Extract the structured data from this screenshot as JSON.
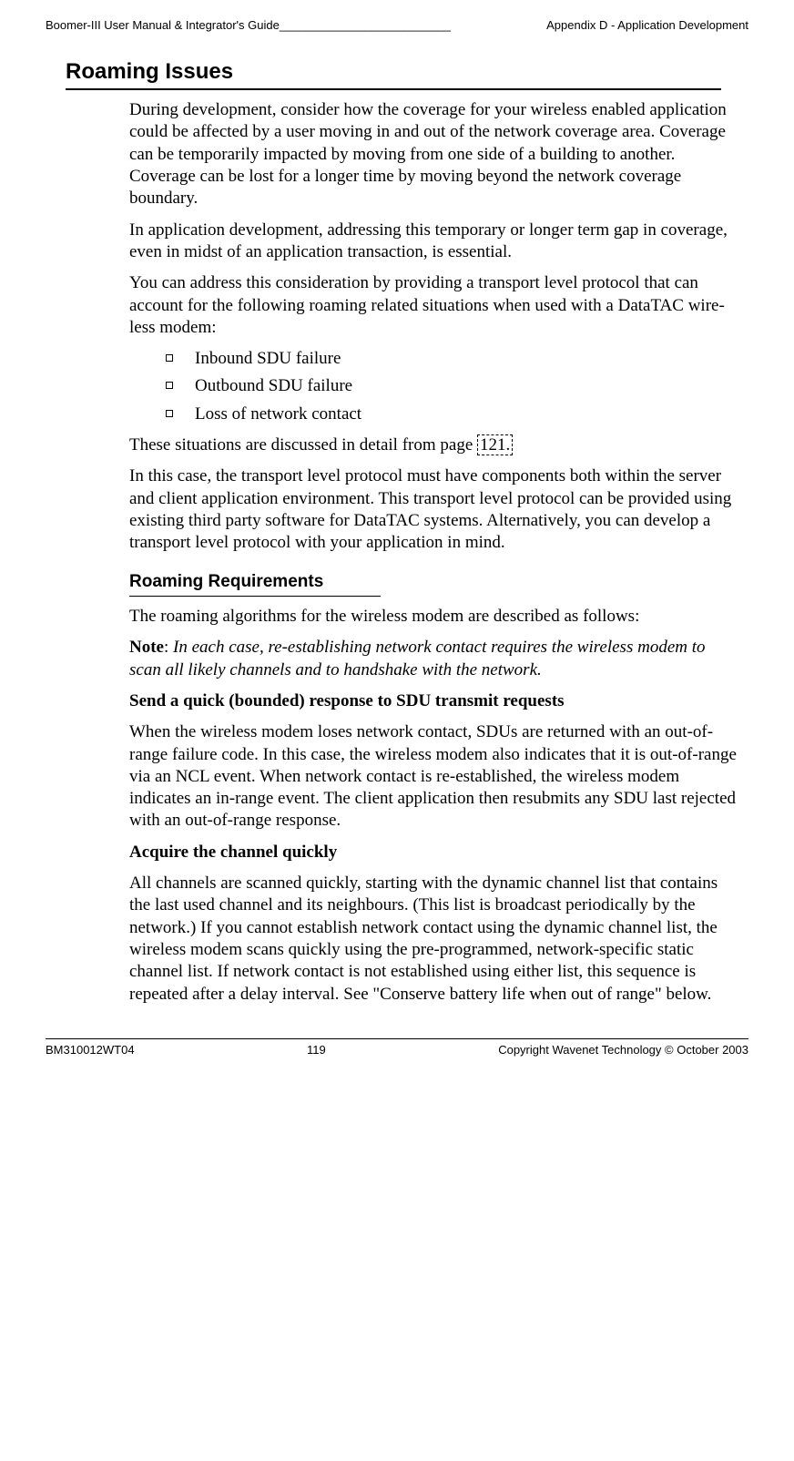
{
  "header": {
    "left": "Boomer-III User Manual & Integrator's Guide__________________________",
    "right": "Appendix D - Application Development"
  },
  "title": "Roaming Issues",
  "p1": "During development, consider how the coverage for your wireless enabled application could be affected by a user moving in and out of the network coverage area. Coverage can be temporarily impacted by moving from one side of a building to another. Coverage can be lost for a longer time by moving beyond the network coverage boundary.",
  "p2": "In application development, addressing this temporary or longer term gap in coverage, even in midst of an application transaction, is essential.",
  "p3": "You can address this consideration by providing a transport level protocol that can account for the following roaming related situations when used with a DataTAC wire-less modem:",
  "bullets": {
    "b1": "Inbound SDU failure",
    "b2": "Outbound SDU failure",
    "b3": "Loss of network contact"
  },
  "p4a": "These situations are discussed in detail from page ",
  "p4b": "121.",
  "p5": "In this case, the transport level protocol must have components both within the server and client application environment. This transport level protocol can be provided using existing third party software for DataTAC systems. Alternatively, you can develop a transport level protocol with your application in mind.",
  "subheading": "Roaming Requirements",
  "p6": "The roaming algorithms for the wireless modem are described as follows:",
  "note_label": "Note",
  "note_sep": ": ",
  "note_body": "In each case, re-establishing network contact requires the wireless modem to scan all likely channels and to handshake with the network.",
  "runin1": "Send a quick (bounded) response to SDU transmit requests",
  "p7": "When the wireless modem loses network contact, SDUs are returned with an out-of-range failure code. In this case, the wireless modem also indicates that it is out-of-range via an NCL event. When network contact is re-established, the wireless modem indicates an in-range event. The client application then resubmits any SDU last rejected with an out-of-range response.",
  "runin2": "Acquire the channel quickly",
  "p8": "All channels are scanned quickly, starting with the dynamic channel list that contains the last used channel and its neighbours. (This list is broadcast periodically by the network.) If you cannot establish network contact using the dynamic channel list, the wireless modem scans quickly using the pre-programmed, network-specific static channel list. If network contact is not established using either list, this sequence is repeated after a delay interval. See \"Conserve battery life when out of range\" below.",
  "footer": {
    "left": "BM310012WT04",
    "center": "119",
    "right": "Copyright Wavenet Technology © October 2003"
  }
}
